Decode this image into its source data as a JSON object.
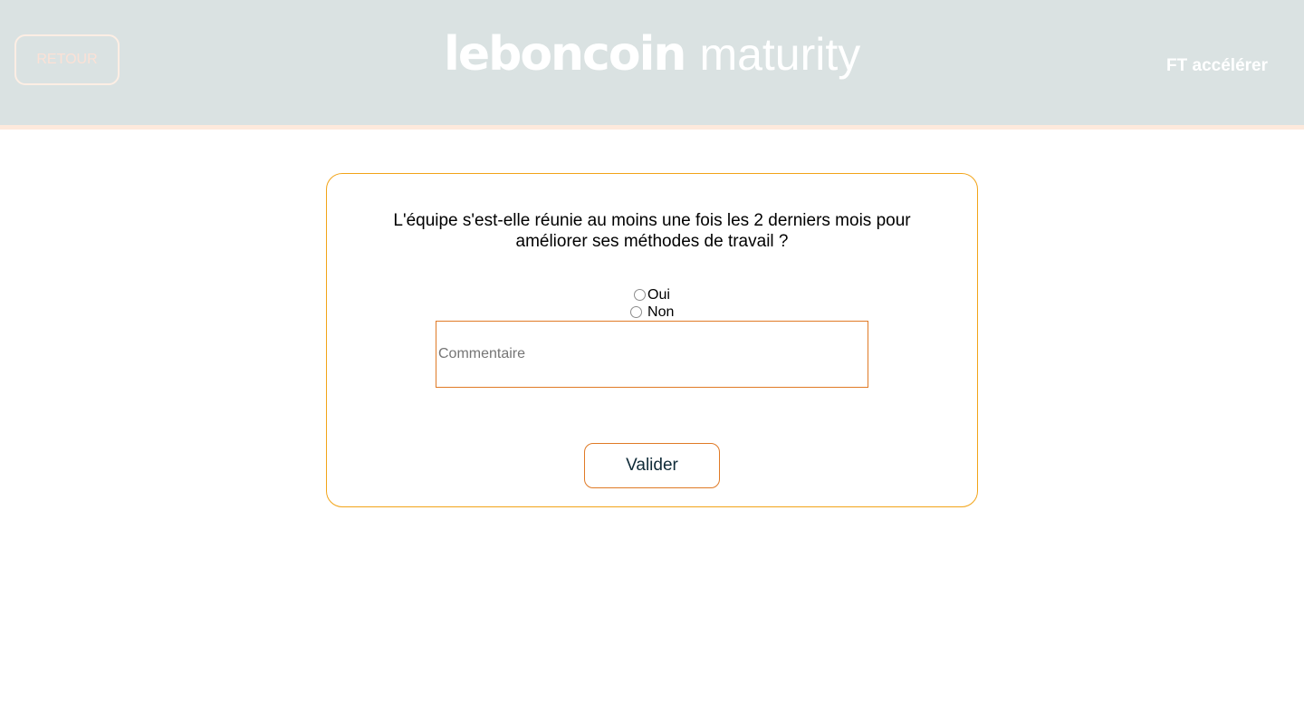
{
  "header": {
    "back_label": "RETOUR",
    "logo_brand": "leboncoin",
    "logo_suffix": "maturity",
    "team_name": "FT accélérer"
  },
  "form": {
    "question": "L'équipe s'est-elle réunie au moins une fois les 2 derniers mois pour améliorer ses méthodes de travail ?",
    "options": [
      {
        "label": "Oui",
        "selected": false
      },
      {
        "label": "Non",
        "selected": false
      }
    ],
    "comment_placeholder": "Commentaire",
    "submit_label": "Valider"
  },
  "colors": {
    "header_bg": "#dae2e2",
    "header_stripe": "#fde9dc",
    "card_border": "#f2a418",
    "accent_orange": "#e07a26"
  }
}
